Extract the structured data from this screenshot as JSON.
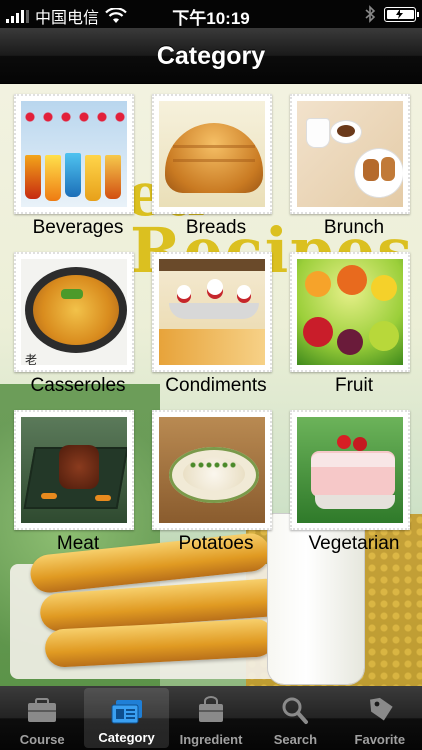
{
  "status": {
    "carrier": "中国电信",
    "time": "下午10:19"
  },
  "navbar": {
    "title": "Category"
  },
  "background": {
    "word1": "ea",
    "word2": "Recipes"
  },
  "categories": [
    {
      "label": "Beverages",
      "icon": "beverages-photo"
    },
    {
      "label": "Breads",
      "icon": "breads-photo"
    },
    {
      "label": "Brunch",
      "icon": "brunch-photo"
    },
    {
      "label": "Casseroles",
      "icon": "casseroles-photo"
    },
    {
      "label": "Condiments",
      "icon": "condiments-photo"
    },
    {
      "label": "Fruit",
      "icon": "fruit-photo"
    },
    {
      "label": "Meat",
      "icon": "meat-photo"
    },
    {
      "label": "Potatoes",
      "icon": "potatoes-photo"
    },
    {
      "label": "Vegetarian",
      "icon": "vegetarian-photo"
    }
  ],
  "tabs": [
    {
      "label": "Course",
      "icon": "briefcase-icon",
      "active": false
    },
    {
      "label": "Category",
      "icon": "category-cards-icon",
      "active": true
    },
    {
      "label": "Ingredient",
      "icon": "bag-icon",
      "active": false
    },
    {
      "label": "Search",
      "icon": "search-icon",
      "active": false
    },
    {
      "label": "Favorite",
      "icon": "tag-icon",
      "active": false
    }
  ],
  "colors": {
    "active_tab_text": "#ffffff",
    "inactive_tab_text": "#a0a0a0",
    "bar_dark": "#050505"
  }
}
